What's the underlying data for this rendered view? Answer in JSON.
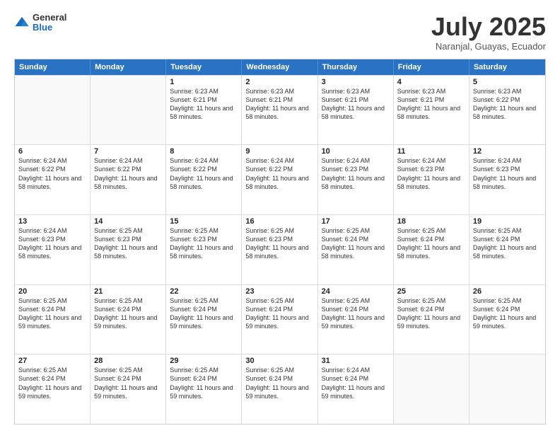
{
  "header": {
    "logo_general": "General",
    "logo_blue": "Blue",
    "month": "July 2025",
    "location": "Naranjal, Guayas, Ecuador"
  },
  "days_of_week": [
    "Sunday",
    "Monday",
    "Tuesday",
    "Wednesday",
    "Thursday",
    "Friday",
    "Saturday"
  ],
  "weeks": [
    [
      {
        "day": "",
        "sunrise": "",
        "sunset": "",
        "daylight": "",
        "empty": true
      },
      {
        "day": "",
        "sunrise": "",
        "sunset": "",
        "daylight": "",
        "empty": true
      },
      {
        "day": "1",
        "sunrise": "Sunrise: 6:23 AM",
        "sunset": "Sunset: 6:21 PM",
        "daylight": "Daylight: 11 hours and 58 minutes."
      },
      {
        "day": "2",
        "sunrise": "Sunrise: 6:23 AM",
        "sunset": "Sunset: 6:21 PM",
        "daylight": "Daylight: 11 hours and 58 minutes."
      },
      {
        "day": "3",
        "sunrise": "Sunrise: 6:23 AM",
        "sunset": "Sunset: 6:21 PM",
        "daylight": "Daylight: 11 hours and 58 minutes."
      },
      {
        "day": "4",
        "sunrise": "Sunrise: 6:23 AM",
        "sunset": "Sunset: 6:21 PM",
        "daylight": "Daylight: 11 hours and 58 minutes."
      },
      {
        "day": "5",
        "sunrise": "Sunrise: 6:23 AM",
        "sunset": "Sunset: 6:22 PM",
        "daylight": "Daylight: 11 hours and 58 minutes."
      }
    ],
    [
      {
        "day": "6",
        "sunrise": "Sunrise: 6:24 AM",
        "sunset": "Sunset: 6:22 PM",
        "daylight": "Daylight: 11 hours and 58 minutes."
      },
      {
        "day": "7",
        "sunrise": "Sunrise: 6:24 AM",
        "sunset": "Sunset: 6:22 PM",
        "daylight": "Daylight: 11 hours and 58 minutes."
      },
      {
        "day": "8",
        "sunrise": "Sunrise: 6:24 AM",
        "sunset": "Sunset: 6:22 PM",
        "daylight": "Daylight: 11 hours and 58 minutes."
      },
      {
        "day": "9",
        "sunrise": "Sunrise: 6:24 AM",
        "sunset": "Sunset: 6:22 PM",
        "daylight": "Daylight: 11 hours and 58 minutes."
      },
      {
        "day": "10",
        "sunrise": "Sunrise: 6:24 AM",
        "sunset": "Sunset: 6:23 PM",
        "daylight": "Daylight: 11 hours and 58 minutes."
      },
      {
        "day": "11",
        "sunrise": "Sunrise: 6:24 AM",
        "sunset": "Sunset: 6:23 PM",
        "daylight": "Daylight: 11 hours and 58 minutes."
      },
      {
        "day": "12",
        "sunrise": "Sunrise: 6:24 AM",
        "sunset": "Sunset: 6:23 PM",
        "daylight": "Daylight: 11 hours and 58 minutes."
      }
    ],
    [
      {
        "day": "13",
        "sunrise": "Sunrise: 6:24 AM",
        "sunset": "Sunset: 6:23 PM",
        "daylight": "Daylight: 11 hours and 58 minutes."
      },
      {
        "day": "14",
        "sunrise": "Sunrise: 6:25 AM",
        "sunset": "Sunset: 6:23 PM",
        "daylight": "Daylight: 11 hours and 58 minutes."
      },
      {
        "day": "15",
        "sunrise": "Sunrise: 6:25 AM",
        "sunset": "Sunset: 6:23 PM",
        "daylight": "Daylight: 11 hours and 58 minutes."
      },
      {
        "day": "16",
        "sunrise": "Sunrise: 6:25 AM",
        "sunset": "Sunset: 6:23 PM",
        "daylight": "Daylight: 11 hours and 58 minutes."
      },
      {
        "day": "17",
        "sunrise": "Sunrise: 6:25 AM",
        "sunset": "Sunset: 6:24 PM",
        "daylight": "Daylight: 11 hours and 58 minutes."
      },
      {
        "day": "18",
        "sunrise": "Sunrise: 6:25 AM",
        "sunset": "Sunset: 6:24 PM",
        "daylight": "Daylight: 11 hours and 58 minutes."
      },
      {
        "day": "19",
        "sunrise": "Sunrise: 6:25 AM",
        "sunset": "Sunset: 6:24 PM",
        "daylight": "Daylight: 11 hours and 58 minutes."
      }
    ],
    [
      {
        "day": "20",
        "sunrise": "Sunrise: 6:25 AM",
        "sunset": "Sunset: 6:24 PM",
        "daylight": "Daylight: 11 hours and 59 minutes."
      },
      {
        "day": "21",
        "sunrise": "Sunrise: 6:25 AM",
        "sunset": "Sunset: 6:24 PM",
        "daylight": "Daylight: 11 hours and 59 minutes."
      },
      {
        "day": "22",
        "sunrise": "Sunrise: 6:25 AM",
        "sunset": "Sunset: 6:24 PM",
        "daylight": "Daylight: 11 hours and 59 minutes."
      },
      {
        "day": "23",
        "sunrise": "Sunrise: 6:25 AM",
        "sunset": "Sunset: 6:24 PM",
        "daylight": "Daylight: 11 hours and 59 minutes."
      },
      {
        "day": "24",
        "sunrise": "Sunrise: 6:25 AM",
        "sunset": "Sunset: 6:24 PM",
        "daylight": "Daylight: 11 hours and 59 minutes."
      },
      {
        "day": "25",
        "sunrise": "Sunrise: 6:25 AM",
        "sunset": "Sunset: 6:24 PM",
        "daylight": "Daylight: 11 hours and 59 minutes."
      },
      {
        "day": "26",
        "sunrise": "Sunrise: 6:25 AM",
        "sunset": "Sunset: 6:24 PM",
        "daylight": "Daylight: 11 hours and 59 minutes."
      }
    ],
    [
      {
        "day": "27",
        "sunrise": "Sunrise: 6:25 AM",
        "sunset": "Sunset: 6:24 PM",
        "daylight": "Daylight: 11 hours and 59 minutes."
      },
      {
        "day": "28",
        "sunrise": "Sunrise: 6:25 AM",
        "sunset": "Sunset: 6:24 PM",
        "daylight": "Daylight: 11 hours and 59 minutes."
      },
      {
        "day": "29",
        "sunrise": "Sunrise: 6:25 AM",
        "sunset": "Sunset: 6:24 PM",
        "daylight": "Daylight: 11 hours and 59 minutes."
      },
      {
        "day": "30",
        "sunrise": "Sunrise: 6:25 AM",
        "sunset": "Sunset: 6:24 PM",
        "daylight": "Daylight: 11 hours and 59 minutes."
      },
      {
        "day": "31",
        "sunrise": "Sunrise: 6:24 AM",
        "sunset": "Sunset: 6:24 PM",
        "daylight": "Daylight: 11 hours and 59 minutes."
      },
      {
        "day": "",
        "sunrise": "",
        "sunset": "",
        "daylight": "",
        "empty": true
      },
      {
        "day": "",
        "sunrise": "",
        "sunset": "",
        "daylight": "",
        "empty": true
      }
    ]
  ]
}
